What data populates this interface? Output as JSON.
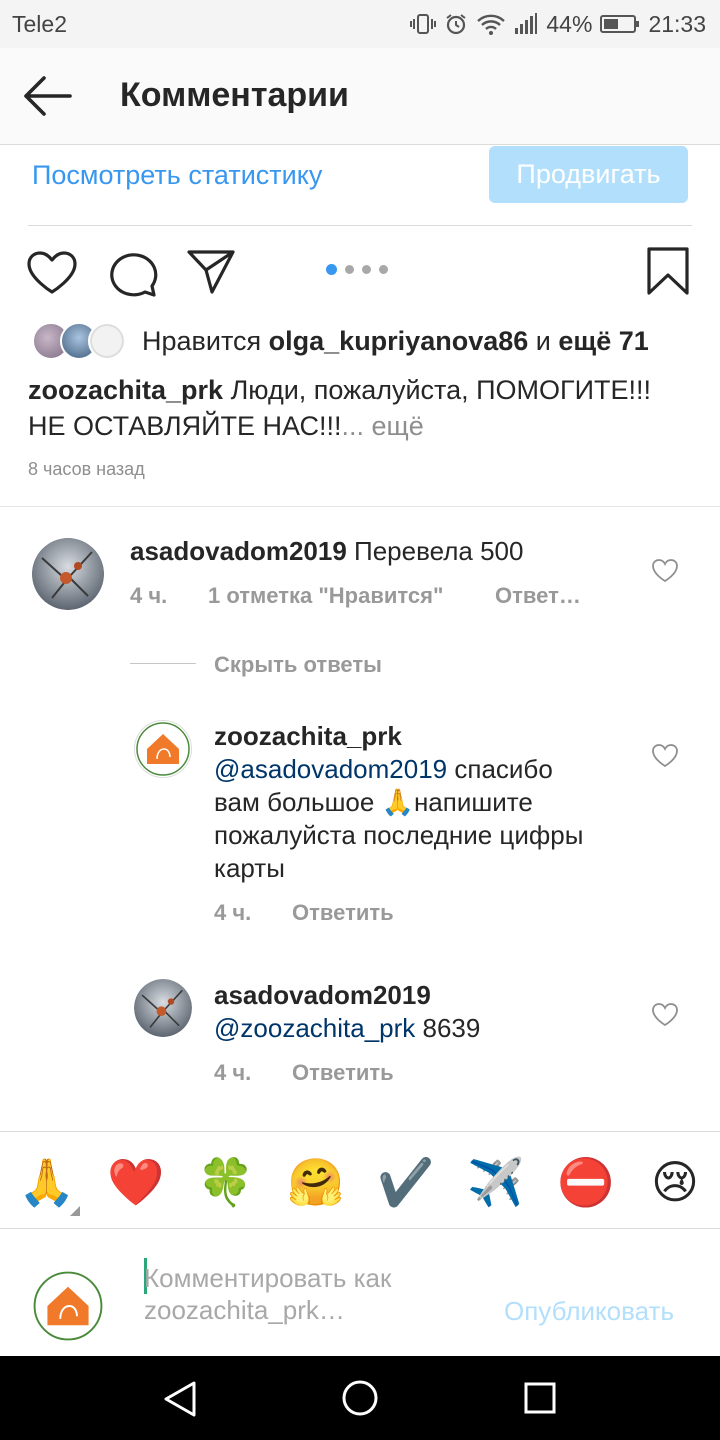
{
  "status_bar": {
    "carrier": "Tele2",
    "battery": "44%",
    "time": "21:33",
    "icons": [
      "vibrate-icon",
      "alarm-icon",
      "wifi-icon",
      "signal-icon",
      "battery-icon"
    ]
  },
  "header": {
    "back_icon": "arrow-left-icon",
    "title": "Комментарии"
  },
  "stats": {
    "view_stats": "Посмотреть статистику",
    "promote": "Продвигать"
  },
  "actions": {
    "icons": [
      "heart-icon",
      "comment-icon",
      "share-icon",
      "bookmark-icon"
    ],
    "carousel_page": 1,
    "carousel_total": 4
  },
  "likes": {
    "prefix": "Нравится",
    "user": "olga_kupriyanova86",
    "joiner": "и",
    "others": "ещё 71"
  },
  "caption": {
    "username": "zoozachita_prk",
    "text": "Люди, пожалуйста, ПОМОГИТЕ!!! НЕ ОСТАВЛЯЙТЕ НАС!!!",
    "more": "... ещё",
    "time": "8 часов назад"
  },
  "comments": [
    {
      "username": "asadovadom2019",
      "text": "Перевела 500",
      "time": "4 ч.",
      "likes": "1 отметка \"Нравится\"",
      "reply": "Ответ…"
    }
  ],
  "hide_replies": "Скрыть ответы",
  "replies": [
    {
      "username": "zoozachita_prk",
      "mention": "@asadovadom2019",
      "line1": "спасибо",
      "line2": "вам большое 🙏напишите",
      "line3": "пожалуйста последние цифры",
      "line4": "карты",
      "time": "4 ч.",
      "reply": "Ответить"
    },
    {
      "username": "asadovadom2019",
      "mention": "@zoozachita_prk",
      "text": "8639",
      "time": "4 ч.",
      "reply": "Ответить"
    }
  ],
  "emoji_bar": [
    "🙏",
    "❤️",
    "🍀",
    "🤗",
    "✔️",
    "✈️",
    "⛔",
    "😢"
  ],
  "compose": {
    "placeholder_line1": "Комментировать как",
    "placeholder_line2": "zoozachita_prk…",
    "publish": "Опубликовать"
  },
  "navbar": {
    "icons": [
      "back-triangle-icon",
      "home-circle-icon",
      "recents-square-icon"
    ]
  }
}
